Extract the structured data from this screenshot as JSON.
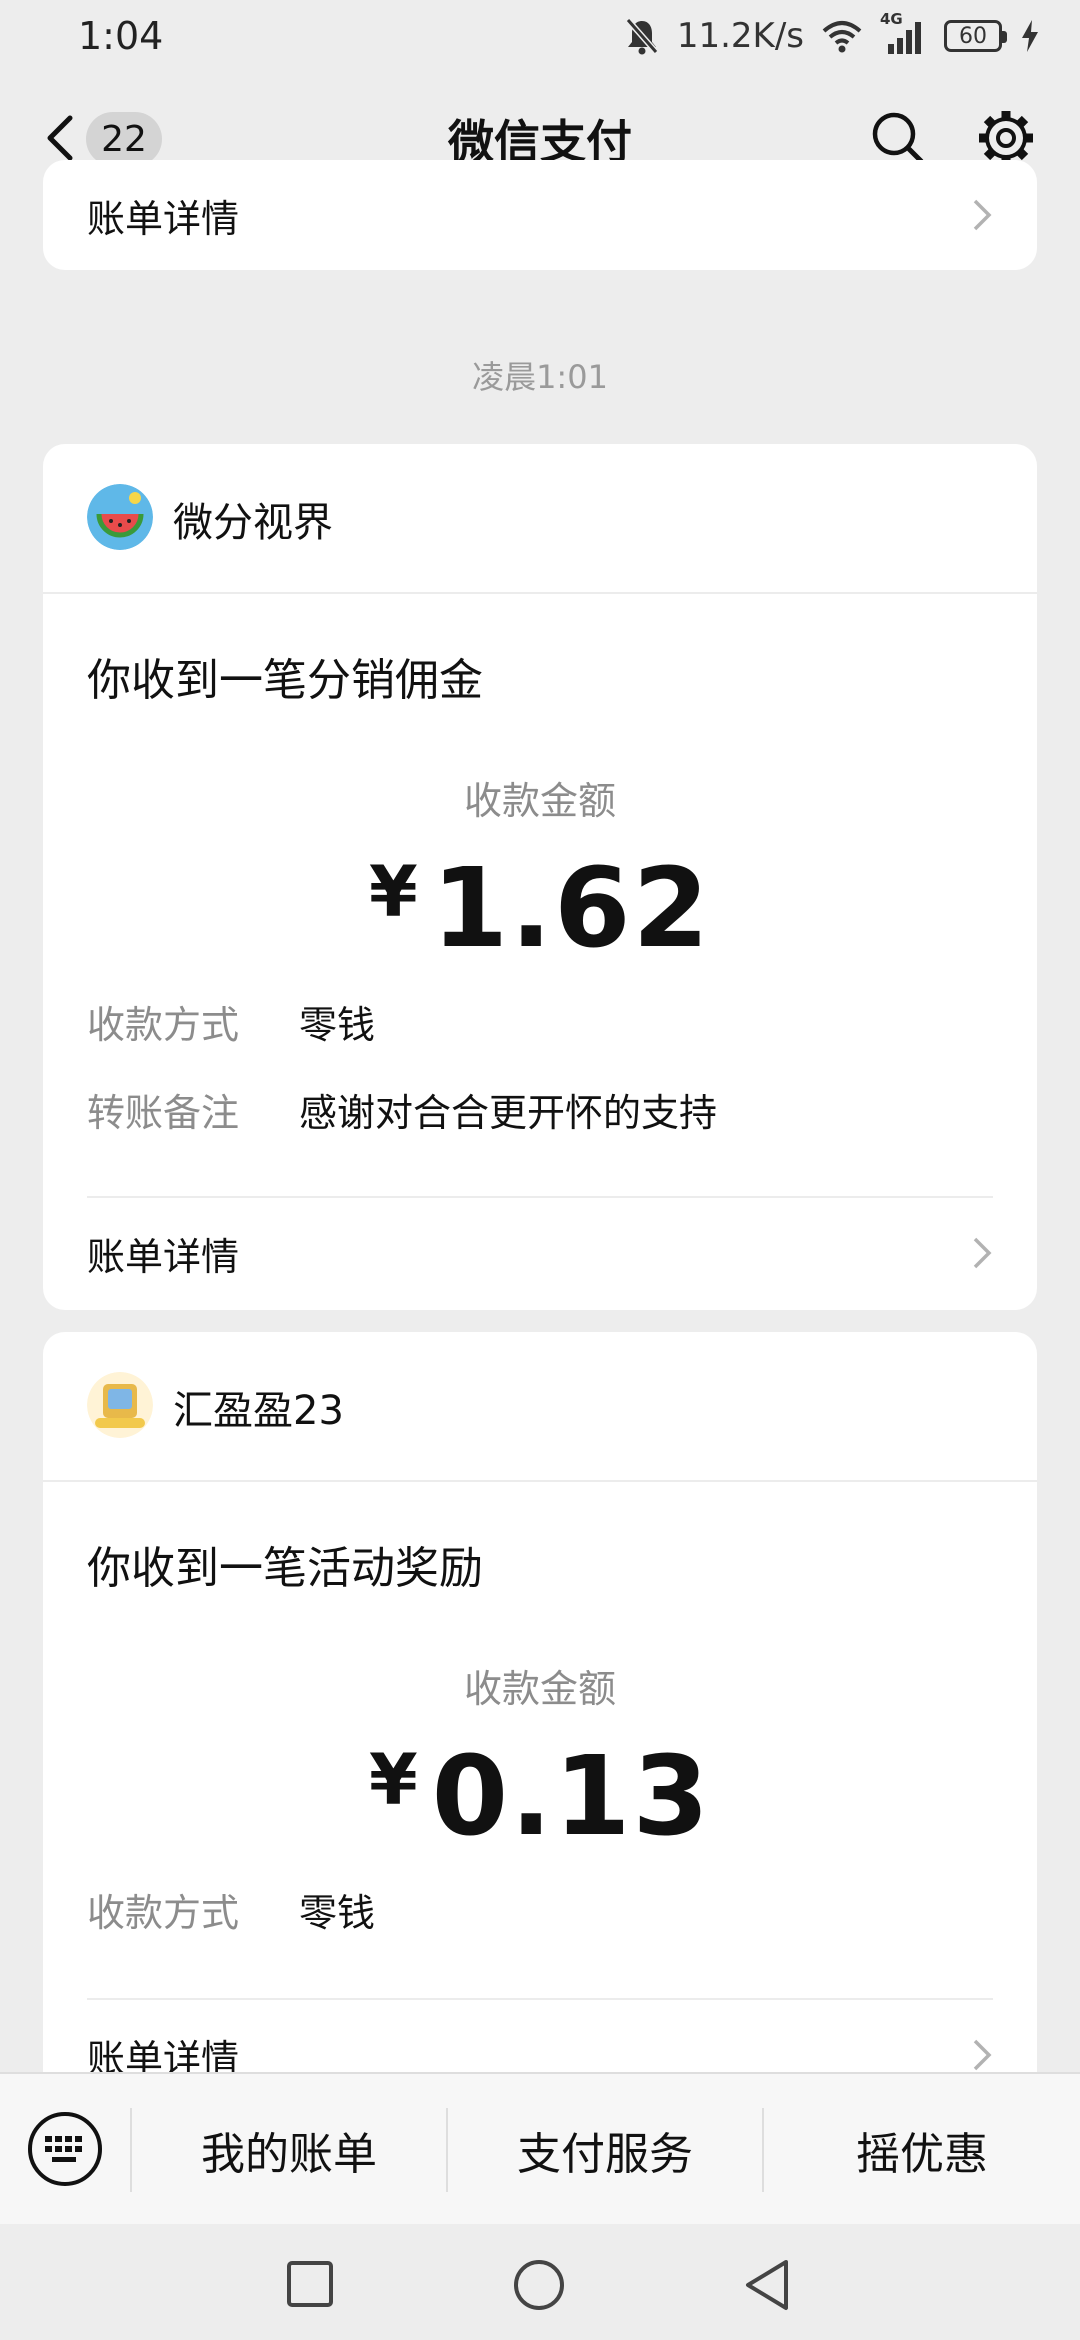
{
  "status_bar": {
    "time": "1:04",
    "net_speed": "11.2K/s",
    "network": "4G",
    "battery": "60"
  },
  "nav": {
    "unread_count": "22",
    "title": "微信支付"
  },
  "top_card": {
    "bill_details": "账单详情"
  },
  "timestamp": "凌晨1:01",
  "cards": [
    {
      "merchant": "微分视界",
      "title": "你收到一笔分销佣金",
      "amount_label": "收款金额",
      "currency": "¥",
      "amount": "1.62",
      "method_label": "收款方式",
      "method_value": "零钱",
      "note_label": "转账备注",
      "note_value": "感谢对合合更开怀的支持",
      "bill_details": "账单详情"
    },
    {
      "merchant": "汇盈盈23",
      "title": "你收到一笔活动奖励",
      "amount_label": "收款金额",
      "currency": "¥",
      "amount": "0.13",
      "method_label": "收款方式",
      "method_value": "零钱",
      "bill_details": "账单详情"
    }
  ],
  "bottom_menu": {
    "items": [
      "我的账单",
      "支付服务",
      "摇优惠"
    ]
  },
  "icons": [
    "back-icon",
    "search-icon",
    "gear-icon",
    "chevron-right-icon",
    "keyboard-icon",
    "recent-apps-icon",
    "home-icon",
    "system-back-icon"
  ]
}
